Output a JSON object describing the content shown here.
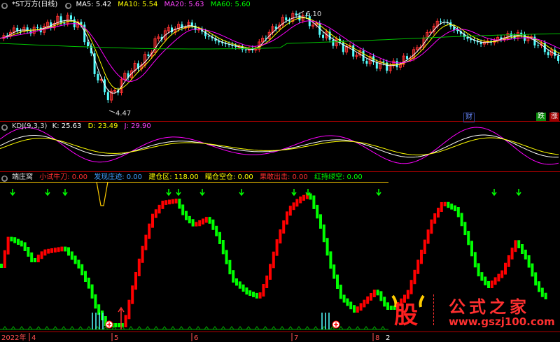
{
  "main_panel": {
    "symbol": "*ST万方(日线)",
    "ma5": {
      "label": "MA5:",
      "value": "5.42",
      "color": "#ffffff"
    },
    "ma10": {
      "label": "MA10:",
      "value": "5.54",
      "color": "#ffff00"
    },
    "ma20": {
      "label": "MA20:",
      "value": "5.63",
      "color": "#ff00ff"
    },
    "ma60": {
      "label": "MA60:",
      "value": "5.60",
      "color": "#00ff00"
    },
    "high_label": "6.10",
    "low_label": "4.47",
    "badge_cai": "财",
    "badge_die": "跌",
    "badge_zhang": "涨"
  },
  "kdj_panel": {
    "name": "KDJ(9,3,3)",
    "k": "K: 25.63",
    "d": "D: 23.49",
    "j": "J: 29.90"
  },
  "zhuang_panel": {
    "name": "端庄窝",
    "items": [
      {
        "text": "小试牛刀: 0.00",
        "color": "#ff3030"
      },
      {
        "text": "发现庄迹: 0.00",
        "color": "#40a0ff"
      },
      {
        "text": "建仓区: 118.00",
        "color": "#ffff00"
      },
      {
        "text": "瞄仓空仓: 0.00",
        "color": "#ffff00"
      },
      {
        "text": "果敢出击: 0.00",
        "color": "#ff3030"
      },
      {
        "text": "红持绿空: 0.00",
        "color": "#00ff00"
      }
    ]
  },
  "x_axis": {
    "labels": [
      "2022年",
      "4",
      "5",
      "6",
      "7",
      "8",
      "2"
    ]
  },
  "watermark": {
    "logo_char": "股",
    "site_name": "公式之家",
    "url": "www.gszj100.com"
  },
  "colors": {
    "up": "#ff3232",
    "down": "#54ffff",
    "green_bar": "#00ff00",
    "red_bar": "#ff0000"
  }
}
